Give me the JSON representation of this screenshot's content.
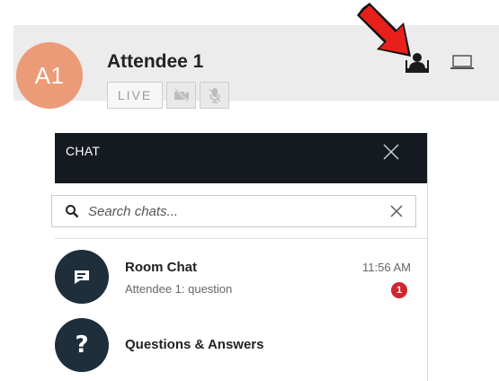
{
  "attendee": {
    "initials": "A1",
    "name": "Attendee 1",
    "status_badge": "LIVE",
    "avatar_color": "#ec9b78",
    "video_icon": "video-off-icon",
    "mic_icon": "mic-off-icon",
    "view_icons": [
      "attendee-view-icon",
      "screen-view-icon"
    ]
  },
  "annotation": {
    "arrow_color": "#e8201c",
    "arrow_icon": "red-arrow"
  },
  "chat": {
    "title": "CHAT",
    "header_color": "#151a20",
    "search": {
      "placeholder": "Search chats..."
    },
    "items": [
      {
        "name": "Room Chat",
        "preview": "Attendee 1: question",
        "time": "11:56 AM",
        "unread": "1",
        "icon": "chat-bubble-icon"
      },
      {
        "name": "Questions & Answers",
        "icon": "question-mark-icon",
        "glyph": "?"
      }
    ]
  }
}
